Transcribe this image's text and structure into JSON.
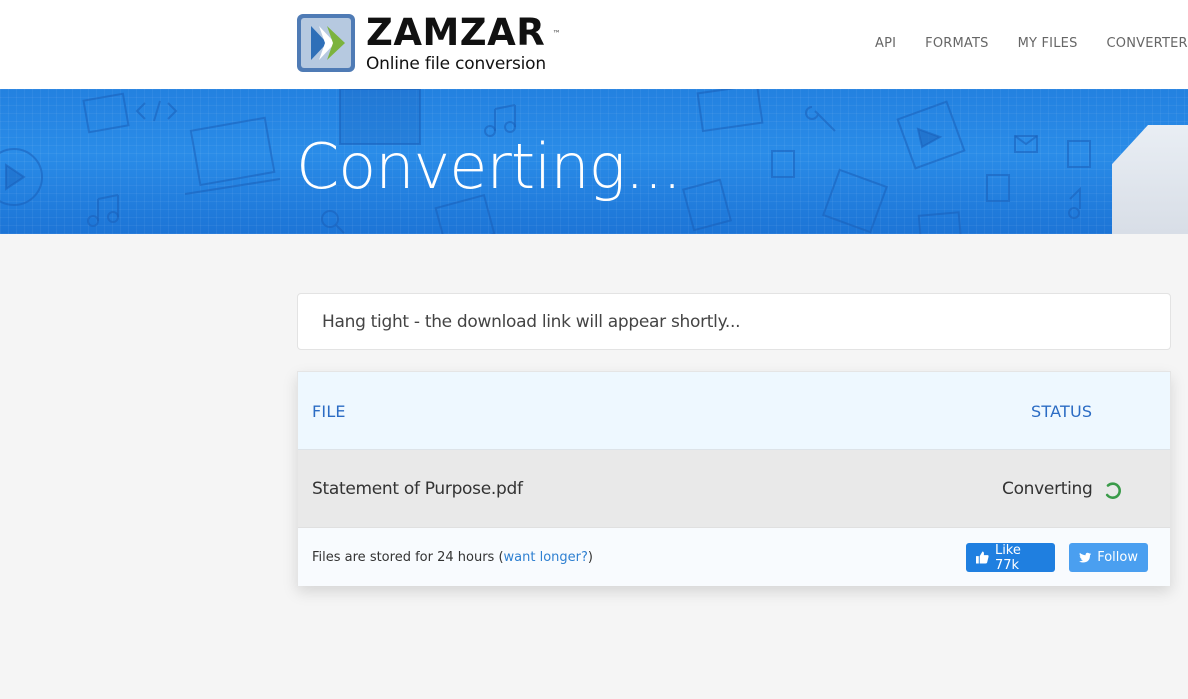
{
  "header": {
    "logo": {
      "name": "ZAMZAR",
      "trademark": "™",
      "tagline": "Online file conversion"
    },
    "nav": [
      "API",
      "FORMATS",
      "MY FILES",
      "CONVERTERS"
    ]
  },
  "banner": {
    "title": "Converting..."
  },
  "notice": {
    "text": "Hang tight - the download link will appear shortly..."
  },
  "files_table": {
    "columns": {
      "file": "FILE",
      "status": "STATUS"
    },
    "rows": [
      {
        "file_name": "Statement of Purpose.pdf",
        "status": "Converting",
        "status_icon": "spinner-icon"
      }
    ],
    "footer": {
      "storage_text": "Files are stored for 24 hours (",
      "want_longer_link": "want longer?",
      "closing_paren": ")",
      "like_button": "Like 77k",
      "follow_button": "Follow"
    }
  },
  "colors": {
    "accent_blue": "#2b6cc4",
    "banner_blue": "#2381e0",
    "like_blue": "#1f7fe0",
    "twitter_blue": "#4a9ff0",
    "spinner_green": "#3a9b4a",
    "logo_green": "#7cb33d"
  }
}
